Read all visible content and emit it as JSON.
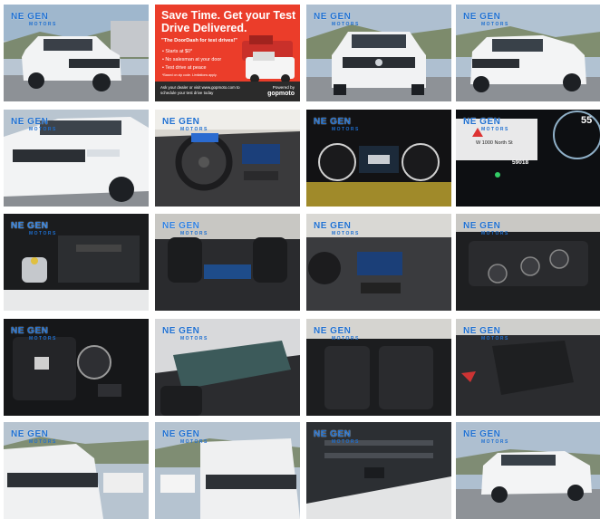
{
  "gallery": {
    "watermark": {
      "brand": "NE GEN",
      "sub": "MOTORS"
    },
    "ad": {
      "headline": "Save Time. Get your Test Drive Delivered.",
      "subhead": "\"The DoorDash for test drives!\"",
      "bullets": [
        "Starts at $0*",
        "No salesman at your door",
        "Test drive at peace"
      ],
      "fine_print": "*Based on zip code. Limitations apply.",
      "footer_text": "Ask your dealer or visit www.gopmoto.com to schedule your test drive today",
      "powered_by": "Powered by",
      "powered_brand": "gopmoto"
    },
    "cluster": {
      "odometer": "59018",
      "speed": "55",
      "address": "W 1000 North St"
    },
    "colors": {
      "accent": "#1e6fd0",
      "ad_red": "#eb3d2a"
    }
  }
}
